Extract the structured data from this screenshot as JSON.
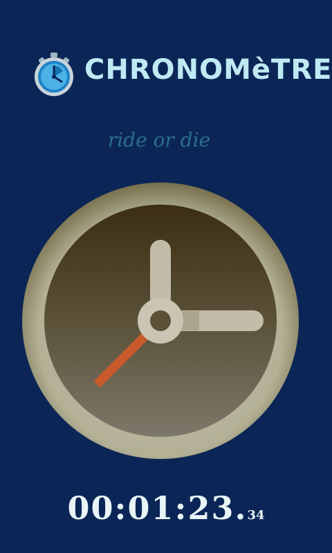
{
  "app": {
    "title": "CHRONOMèTRE",
    "tagline": "ride or die",
    "icon": "stopwatch-icon"
  },
  "clock": {
    "icon": "clock-face",
    "bezel_color": "#c3c2ad",
    "face_color": "#6a6148",
    "hand_color": "#c2bda9",
    "second_hand_color": "#c95a2a"
  },
  "timer": {
    "main": "00:01:23.",
    "ms": "34"
  },
  "colors": {
    "background": "#0b2656",
    "title": "#bfe9f3",
    "tagline": "#2d6e8a"
  }
}
